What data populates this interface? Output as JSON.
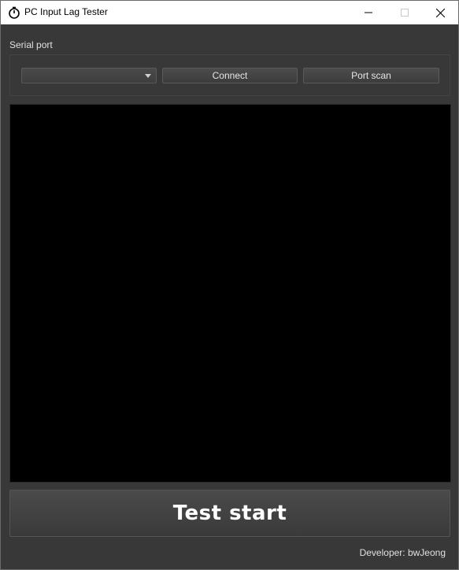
{
  "window": {
    "title": "PC Input Lag Tester",
    "icons": {
      "app": "timer-icon",
      "minimize": "minimize-icon",
      "maximize": "maximize-icon",
      "close": "close-icon"
    }
  },
  "serial": {
    "label": "Serial port",
    "port_select_value": "",
    "connect_label": "Connect",
    "scan_label": "Port scan"
  },
  "main": {
    "test_start_label": "Test start"
  },
  "footer": {
    "developer": "Developer: bwJeong"
  },
  "colors": {
    "background": "#383838",
    "display": "#000000",
    "titlebar": "#ffffff"
  }
}
